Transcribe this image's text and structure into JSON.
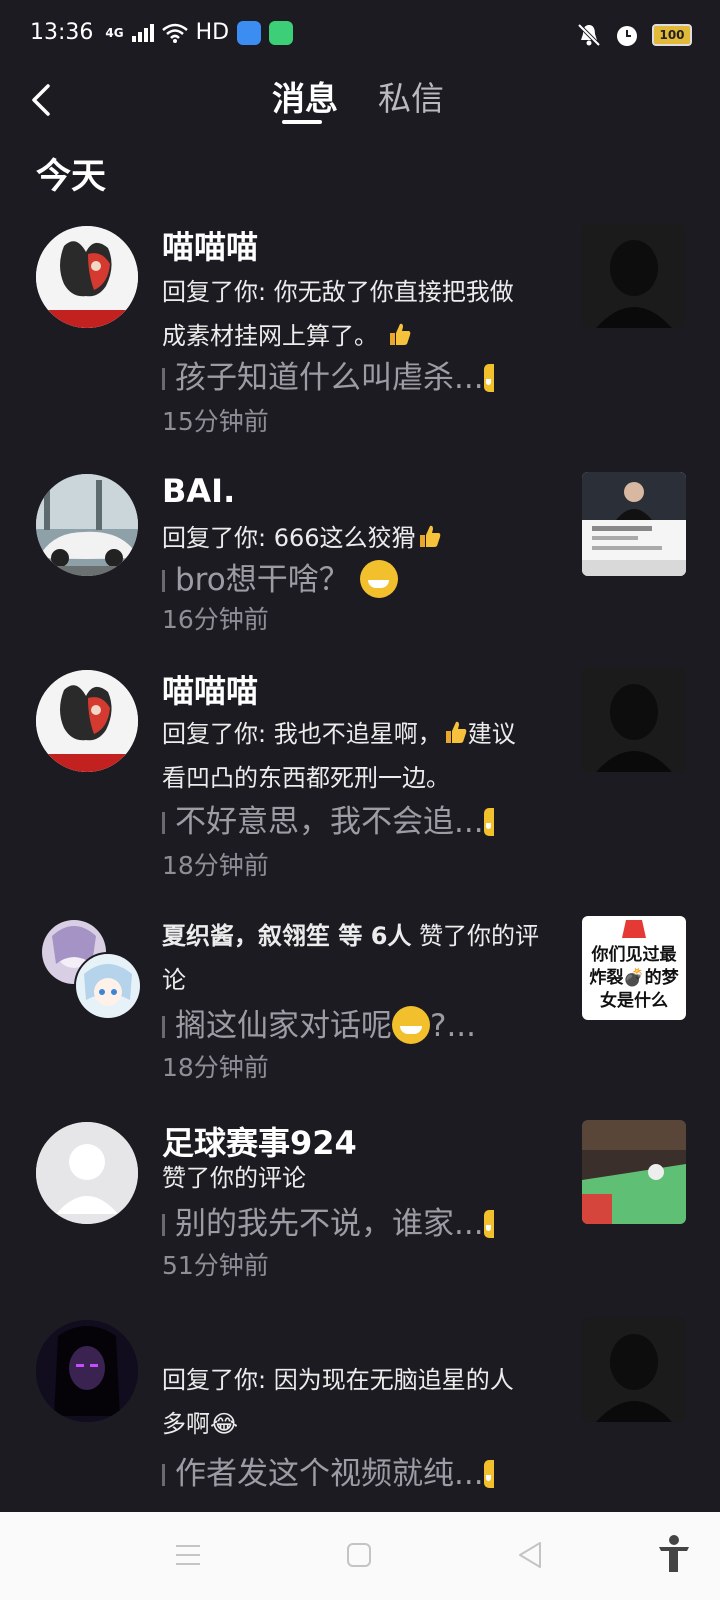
{
  "status_bar": {
    "time": "13:36",
    "network": "4G",
    "hd": "HD",
    "battery": "100"
  },
  "header": {
    "tabs": [
      {
        "label": "消息",
        "active": true
      },
      {
        "label": "私信",
        "active": false
      }
    ]
  },
  "section_title": "今天",
  "notifications": [
    {
      "name": "喵喵喵",
      "message": "回复了你: 你无敌了你直接把我做成素材挂网上算了。",
      "quote": "孩子知道什么叫虐杀...",
      "time": "15分钟前"
    },
    {
      "name": "BAI.",
      "message": "回复了你: 666这么狡猾",
      "quote": "bro想干啥？",
      "time": "16分钟前"
    },
    {
      "name": "喵喵喵",
      "message_a": "回复了你: 我也不追星啊，",
      "message_b": "建议看凹凸的东西都死刑一边。",
      "quote": "不好意思，我不会追...",
      "time": "18分钟前"
    },
    {
      "names": "夏织酱，叙翎笙 等 6人",
      "action": "赞了你的评论",
      "quote_a": "搁这仙家对话呢",
      "quote_b": "?...",
      "time": "18分钟前",
      "thumb_text": "你们见过最炸裂💣的梦女是什么"
    },
    {
      "name": "足球赛事924",
      "message": "赞了你的评论",
      "quote": "别的我先不说，谁家...",
      "time": "51分钟前"
    },
    {
      "name": "",
      "message": "回复了你: 因为现在无脑追星的人多啊😂",
      "quote": "作者发这个视频就纯..."
    }
  ]
}
